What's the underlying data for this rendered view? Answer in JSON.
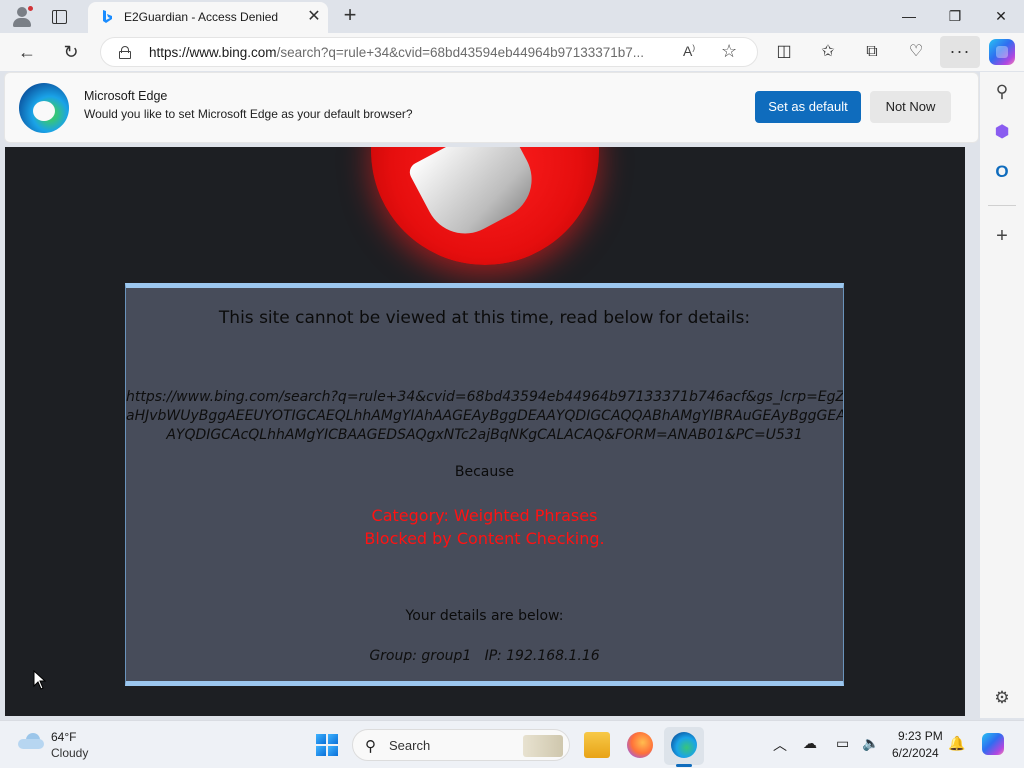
{
  "browser": {
    "tab": {
      "title": "E2Guardian - Access Denied"
    },
    "address_bar": {
      "url_host": "https://www.bing.com",
      "url_rest": "/search?q=rule+34&cvid=68bd43594eb44964b97133371b7..."
    },
    "window_controls": {
      "minimize": "—",
      "restore": "❐",
      "close": "✕"
    }
  },
  "notification": {
    "title": "Microsoft Edge",
    "message": "Would you like to set Microsoft Edge as your default browser?",
    "primary_button": "Set as default",
    "secondary_button": "Not Now"
  },
  "blocked_page": {
    "heading": "This site cannot be viewed at this time, read below for details:",
    "url_lines": [
      "https://www.bing.com/search?q=rule+34&cvid=68bd43594eb44964b97133371b746acf&gs_lcrp=EgZj",
      "aHJvbWUyBggAEEUYOTIGCAEQLhhAMgYIAhAAGEAyBggDEAAYQDIGCAQQABhAMgYIBRAuGEAyBggGEA",
      "AYQDIGCAcQLhhAMgYICBAAGEDSAQgxNTc2ajBqNKgCALACAQ&FORM=ANAB01&PC=U531"
    ],
    "because_label": "Because",
    "reason_lines": [
      "Category: Weighted Phrases",
      "Blocked by Content Checking."
    ],
    "details_label": "Your details are below:",
    "group_ip": "Group: group1   IP: 192.168.1.16",
    "colors": {
      "panel": "#474c5a",
      "border": "#9cc7ef",
      "reason": "#ff1212",
      "background": "#1d1f23"
    }
  },
  "taskbar": {
    "weather": {
      "temp": "64°F",
      "condition": "Cloudy"
    },
    "search_placeholder": "Search",
    "clock": {
      "time": "9:23 PM",
      "date": "6/2/2024"
    },
    "apps": [
      "windows-start-icon",
      "file-explorer-icon",
      "firefox-icon",
      "edge-icon"
    ]
  }
}
